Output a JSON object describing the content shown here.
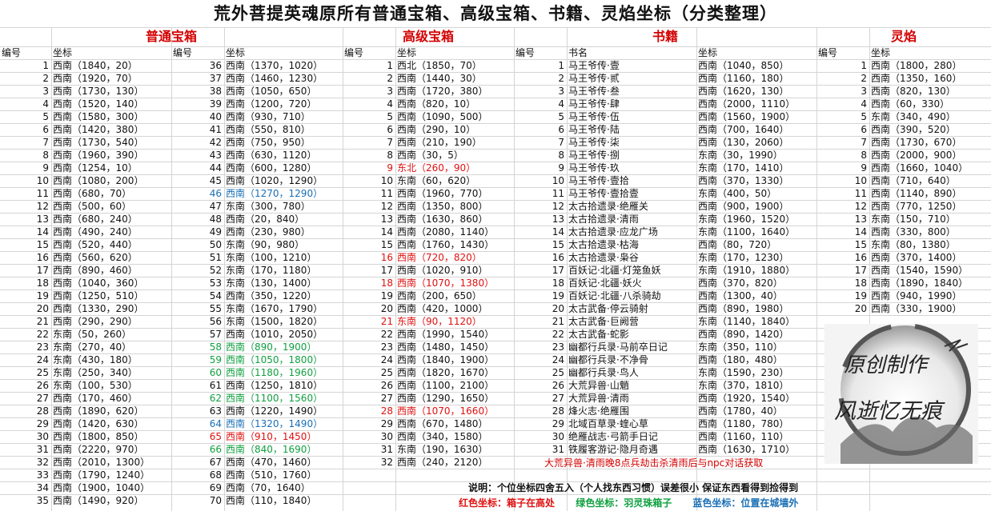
{
  "title": "荒外菩提英魂原所有普通宝箱、高级宝箱、书籍、灵焰坐标（分类整理）",
  "sections": {
    "normal": "普通宝箱",
    "advanced": "高级宝箱",
    "books": "书籍",
    "flame": "灵焰"
  },
  "headers": {
    "num": "编号",
    "coord": "坐标",
    "book": "书名"
  },
  "normal_a": [
    {
      "n": "1",
      "c": "西南（1840，20）",
      "col": ""
    },
    {
      "n": "2",
      "c": "西南（1920，70）",
      "col": ""
    },
    {
      "n": "3",
      "c": "西南（1730，130）",
      "col": ""
    },
    {
      "n": "4",
      "c": "西南（1520，140）",
      "col": ""
    },
    {
      "n": "5",
      "c": "西南（1580，300）",
      "col": ""
    },
    {
      "n": "6",
      "c": "西南（1420，380）",
      "col": ""
    },
    {
      "n": "7",
      "c": "西南（1730，540）",
      "col": ""
    },
    {
      "n": "8",
      "c": "西南（1960，390）",
      "col": ""
    },
    {
      "n": "9",
      "c": "西南（1254，10）",
      "col": ""
    },
    {
      "n": "10",
      "c": "西南（1080，200）",
      "col": ""
    },
    {
      "n": "11",
      "c": "西南（680，70）",
      "col": ""
    },
    {
      "n": "12",
      "c": "西南（500，60）",
      "col": ""
    },
    {
      "n": "13",
      "c": "西南（680，240）",
      "col": ""
    },
    {
      "n": "14",
      "c": "西南（490，240）",
      "col": ""
    },
    {
      "n": "15",
      "c": "西南（520，440）",
      "col": ""
    },
    {
      "n": "16",
      "c": "西南（560，620）",
      "col": ""
    },
    {
      "n": "17",
      "c": "西南（890，460）",
      "col": ""
    },
    {
      "n": "18",
      "c": "西南（1040，360）",
      "col": ""
    },
    {
      "n": "19",
      "c": "西南（1250，510）",
      "col": ""
    },
    {
      "n": "20",
      "c": "西南（1330，290）",
      "col": ""
    },
    {
      "n": "21",
      "c": "西南（290，290）",
      "col": ""
    },
    {
      "n": "22",
      "c": "东南（50，260）",
      "col": ""
    },
    {
      "n": "23",
      "c": "东南（270，40）",
      "col": ""
    },
    {
      "n": "24",
      "c": "东南（430，180）",
      "col": ""
    },
    {
      "n": "25",
      "c": "东南（250，340）",
      "col": ""
    },
    {
      "n": "26",
      "c": "东南（100，530）",
      "col": ""
    },
    {
      "n": "27",
      "c": "西南（170，460）",
      "col": ""
    },
    {
      "n": "28",
      "c": "西南（1890，620）",
      "col": ""
    },
    {
      "n": "29",
      "c": "西南（1420，630）",
      "col": ""
    },
    {
      "n": "30",
      "c": "西南（1800，850）",
      "col": ""
    },
    {
      "n": "31",
      "c": "西南（2220，970）",
      "col": ""
    },
    {
      "n": "32",
      "c": "西南（2010，1300）",
      "col": ""
    },
    {
      "n": "33",
      "c": "西南（1790，1240）",
      "col": ""
    },
    {
      "n": "34",
      "c": "西南（1900，1040）",
      "col": ""
    },
    {
      "n": "35",
      "c": "西南（1490，920）",
      "col": ""
    }
  ],
  "normal_b": [
    {
      "n": "36",
      "c": "西南（1370，1020）",
      "col": ""
    },
    {
      "n": "37",
      "c": "西南（1460，1230）",
      "col": ""
    },
    {
      "n": "38",
      "c": "西南（1050，650）",
      "col": ""
    },
    {
      "n": "39",
      "c": "西南（1200，720）",
      "col": ""
    },
    {
      "n": "40",
      "c": "西南（930，710）",
      "col": ""
    },
    {
      "n": "41",
      "c": "西南（550，810）",
      "col": ""
    },
    {
      "n": "42",
      "c": "西南（750，950）",
      "col": ""
    },
    {
      "n": "43",
      "c": "西南（630，1120）",
      "col": ""
    },
    {
      "n": "44",
      "c": "西南（600，1280）",
      "col": ""
    },
    {
      "n": "45",
      "c": "西南（1020，1290）",
      "col": ""
    },
    {
      "n": "46",
      "c": "西南（1270，1290）",
      "col": "blue"
    },
    {
      "n": "47",
      "c": "东南（300，780）",
      "col": ""
    },
    {
      "n": "48",
      "c": "西南（20，840）",
      "col": ""
    },
    {
      "n": "49",
      "c": "西南（230，980）",
      "col": ""
    },
    {
      "n": "50",
      "c": "东南（90，980）",
      "col": ""
    },
    {
      "n": "51",
      "c": "东南（100，1210）",
      "col": ""
    },
    {
      "n": "52",
      "c": "东南（170，1180）",
      "col": ""
    },
    {
      "n": "53",
      "c": "东南（130，1400）",
      "col": ""
    },
    {
      "n": "54",
      "c": "西南（350，1220）",
      "col": ""
    },
    {
      "n": "55",
      "c": "东南（1670，1790）",
      "col": ""
    },
    {
      "n": "56",
      "c": "东南（1500，1820）",
      "col": ""
    },
    {
      "n": "57",
      "c": "西南（1010，2050）",
      "col": ""
    },
    {
      "n": "58",
      "c": "西南（890，1900）",
      "col": "green"
    },
    {
      "n": "59",
      "c": "西南（1050，1800）",
      "col": "green"
    },
    {
      "n": "60",
      "c": "西南（1180，1960）",
      "col": "green"
    },
    {
      "n": "61",
      "c": "西南（1250，1810）",
      "col": ""
    },
    {
      "n": "62",
      "c": "西南（1100，1560）",
      "col": "green"
    },
    {
      "n": "63",
      "c": "西南（1220，1490）",
      "col": ""
    },
    {
      "n": "64",
      "c": "西南（1320，1490）",
      "col": "blue"
    },
    {
      "n": "65",
      "c": "西南（910，1450）",
      "col": "red"
    },
    {
      "n": "66",
      "c": "西南（840，1690）",
      "col": "green"
    },
    {
      "n": "67",
      "c": "西南（470，1460）",
      "col": ""
    },
    {
      "n": "68",
      "c": "西南（510，1760）",
      "col": ""
    },
    {
      "n": "69",
      "c": "西南（70，1640）",
      "col": ""
    },
    {
      "n": "70",
      "c": "西南（110，1840）",
      "col": ""
    }
  ],
  "advanced": [
    {
      "n": "1",
      "c": "西北（1850，70）",
      "col": ""
    },
    {
      "n": "2",
      "c": "西南（1440，30）",
      "col": ""
    },
    {
      "n": "3",
      "c": "西南（1720，380）",
      "col": ""
    },
    {
      "n": "4",
      "c": "西南（820，10）",
      "col": ""
    },
    {
      "n": "5",
      "c": "西南（1090，500）",
      "col": ""
    },
    {
      "n": "6",
      "c": "西南（290，10）",
      "col": ""
    },
    {
      "n": "7",
      "c": "西南（210，190）",
      "col": ""
    },
    {
      "n": "8",
      "c": "西南（30，5）",
      "col": ""
    },
    {
      "n": "9",
      "c": "东北（260，90）",
      "col": "red"
    },
    {
      "n": "10",
      "c": "东南（60，620）",
      "col": ""
    },
    {
      "n": "11",
      "c": "西南（1960，770）",
      "col": ""
    },
    {
      "n": "12",
      "c": "西南（1350，800）",
      "col": ""
    },
    {
      "n": "13",
      "c": "西南（1630，860）",
      "col": ""
    },
    {
      "n": "14",
      "c": "西南（2080，1140）",
      "col": ""
    },
    {
      "n": "15",
      "c": "西南（1760，1430）",
      "col": ""
    },
    {
      "n": "16",
      "c": "西南（720，820）",
      "col": "red"
    },
    {
      "n": "17",
      "c": "西南（1020，910）",
      "col": ""
    },
    {
      "n": "18",
      "c": "西南（1070，1380）",
      "col": "red"
    },
    {
      "n": "19",
      "c": "西南（200，650）",
      "col": ""
    },
    {
      "n": "20",
      "c": "西南（420，1000）",
      "col": ""
    },
    {
      "n": "21",
      "c": "东南（90，1120）",
      "col": "red"
    },
    {
      "n": "22",
      "c": "西南（1990，1540）",
      "col": ""
    },
    {
      "n": "23",
      "c": "西南（1480，1450）",
      "col": ""
    },
    {
      "n": "24",
      "c": "西南（1840，1900）",
      "col": ""
    },
    {
      "n": "25",
      "c": "西南（1820，1670）",
      "col": ""
    },
    {
      "n": "26",
      "c": "西南（1100，2100）",
      "col": ""
    },
    {
      "n": "27",
      "c": "西南（1290，1650）",
      "col": ""
    },
    {
      "n": "28",
      "c": "西南（1070，1660）",
      "col": "red"
    },
    {
      "n": "29",
      "c": "西南（670，1480）",
      "col": ""
    },
    {
      "n": "30",
      "c": "西南（340，1580）",
      "col": ""
    },
    {
      "n": "31",
      "c": "东南（190，1630）",
      "col": ""
    },
    {
      "n": "32",
      "c": "西南（240，2120）",
      "col": ""
    }
  ],
  "books": [
    {
      "n": "1",
      "b": "马王爷传·壹",
      "c": "西南（1040，850）"
    },
    {
      "n": "2",
      "b": "马王爷传·贰",
      "c": "西南（1160，180）"
    },
    {
      "n": "3",
      "b": "马王爷传·叁",
      "c": "西南（1620，130）"
    },
    {
      "n": "4",
      "b": "马王爷传·肆",
      "c": "西南（2000，1110）"
    },
    {
      "n": "5",
      "b": "马王爷传·伍",
      "c": "西南（1560，1900）"
    },
    {
      "n": "6",
      "b": "马王爷传·陆",
      "c": "西南（700，1640）"
    },
    {
      "n": "7",
      "b": "马王爷传·柒",
      "c": "西南（130，2060）"
    },
    {
      "n": "8",
      "b": "马王爷传·捌",
      "c": "东南（30，1990）"
    },
    {
      "n": "9",
      "b": "马王爷传·玖",
      "c": "东南（170，1410）"
    },
    {
      "n": "10",
      "b": "马王爷传·壹拾",
      "c": "西南（370，1330）"
    },
    {
      "n": "11",
      "b": "马王爷传·壹拾壹",
      "c": "东南（400，50）"
    },
    {
      "n": "12",
      "b": "太古拾遗录·绝雁关",
      "c": "西南（900，1900）"
    },
    {
      "n": "13",
      "b": "太古拾遗录·清雨",
      "c": "东南（1960，1520）"
    },
    {
      "n": "14",
      "b": "太古拾遗录·应龙广场",
      "c": "东南（1100，1640）"
    },
    {
      "n": "15",
      "b": "太古拾遗录·枯海",
      "c": "西南（80，720）"
    },
    {
      "n": "16",
      "b": "太古拾遗录·枭谷",
      "c": "东南（170，1230）"
    },
    {
      "n": "17",
      "b": "百妖记·北疆·灯笼鱼妖",
      "c": "东南（1910，1880）"
    },
    {
      "n": "18",
      "b": "百妖记·北疆·妖火",
      "c": "西南（370，820）"
    },
    {
      "n": "19",
      "b": "百妖记·北疆·八杀骑劫",
      "c": "西南（1300，40）"
    },
    {
      "n": "20",
      "b": "太古武备·停云骑射",
      "c": "西南（890，1980）"
    },
    {
      "n": "21",
      "b": "太古武备·巨阙营",
      "c": "东南（1140，1840）"
    },
    {
      "n": "22",
      "b": "太古武备·蛇影",
      "c": "西南（890，1420）"
    },
    {
      "n": "23",
      "b": "幽都行兵录·马前卒日记",
      "c": "东南（350，110）"
    },
    {
      "n": "24",
      "b": "幽都行兵录·不净骨",
      "c": "西南（180，480）"
    },
    {
      "n": "25",
      "b": "幽都行兵录·鸟人",
      "c": "东南（1590，230）"
    },
    {
      "n": "26",
      "b": "大荒异兽·山魈",
      "c": "东南（370，1810）"
    },
    {
      "n": "27",
      "b": "大荒异兽·清雨",
      "c": "西南（1920，1540）"
    },
    {
      "n": "28",
      "b": "烽火志·绝雁围",
      "c": "西南（1780，40）"
    },
    {
      "n": "29",
      "b": "北域百草录·蝰心草",
      "c": "西南（1180，780）"
    },
    {
      "n": "30",
      "b": "绝雁战志·弓箭手日记",
      "c": "西南（1160，110）"
    },
    {
      "n": "31",
      "b": "铁履客游记·隐月奇遇",
      "c": "西南（1630，1710）"
    }
  ],
  "book_note": "大荒异兽·清雨晚8点兵劫击杀清雨后与npc对话获取",
  "flame": [
    {
      "n": "1",
      "c": "西南（1800，280）"
    },
    {
      "n": "2",
      "c": "西南（1350，160）"
    },
    {
      "n": "3",
      "c": "西南（820，130）"
    },
    {
      "n": "4",
      "c": "西南（60，330）"
    },
    {
      "n": "5",
      "c": "东南（340，490）"
    },
    {
      "n": "6",
      "c": "西南（390，520）"
    },
    {
      "n": "7",
      "c": "西南（1730，670）"
    },
    {
      "n": "8",
      "c": "西南（2000，900）"
    },
    {
      "n": "9",
      "c": "西南（1660，1040）"
    },
    {
      "n": "10",
      "c": "西南（710，640）"
    },
    {
      "n": "11",
      "c": "西南（1140，890）"
    },
    {
      "n": "12",
      "c": "西南（770，1250）"
    },
    {
      "n": "13",
      "c": "东南（150，710）"
    },
    {
      "n": "14",
      "c": "西南（330，800）"
    },
    {
      "n": "15",
      "c": "东南（80，1380）"
    },
    {
      "n": "16",
      "c": "西南（370，1400）"
    },
    {
      "n": "17",
      "c": "西南（1540，1590）"
    },
    {
      "n": "18",
      "c": "西南（1890，1840）"
    },
    {
      "n": "19",
      "c": "西南（940，1990）"
    },
    {
      "n": "20",
      "c": "西南（330，1900）"
    }
  ],
  "note": "说明：个位坐标四舍五入（个人找东西习惯）误差很小    保证东西看得到捡得到",
  "legend": {
    "red": "红色坐标：箱子在高处",
    "green": "绿色坐标：羽灵珠箱子",
    "blue": "蓝色坐标：位置在城墙外"
  },
  "watermark": {
    "line1": "原创制作",
    "line2": "风逝忆无痕"
  },
  "colors": {
    "red": "#e01010",
    "green": "#10a040",
    "blue": "#1a6fb5",
    "header": "#d40000"
  }
}
